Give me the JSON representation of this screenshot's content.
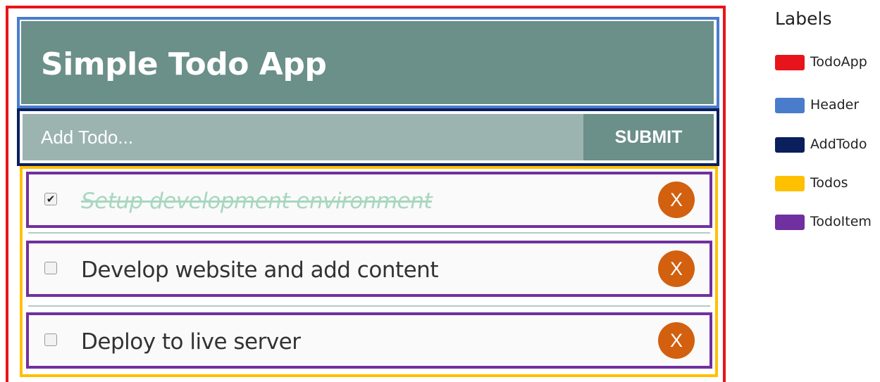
{
  "header": {
    "title": "Simple Todo App"
  },
  "add_todo": {
    "placeholder": "Add Todo...",
    "submit_label": "SUBMIT"
  },
  "todos": [
    {
      "text": "Setup development environment",
      "completed": true,
      "delete_label": "X"
    },
    {
      "text": "Develop website and add content",
      "completed": false,
      "delete_label": "X"
    },
    {
      "text": "Deploy to live server",
      "completed": false,
      "delete_label": "X"
    }
  ],
  "legend": {
    "title": "Labels",
    "items": [
      {
        "label": "TodoApp",
        "color": "#e8141b"
      },
      {
        "label": "Header",
        "color": "#4a7ccc"
      },
      {
        "label": "AddTodo",
        "color": "#0a1f5c"
      },
      {
        "label": "Todos",
        "color": "#ffc000"
      },
      {
        "label": "TodoItem",
        "color": "#7030a0"
      }
    ]
  },
  "colors": {
    "header_bg": "#6b8f89",
    "input_bg": "#9cb4b0",
    "delete_bg": "#d2600f",
    "completed_text": "#a8d7c0"
  }
}
